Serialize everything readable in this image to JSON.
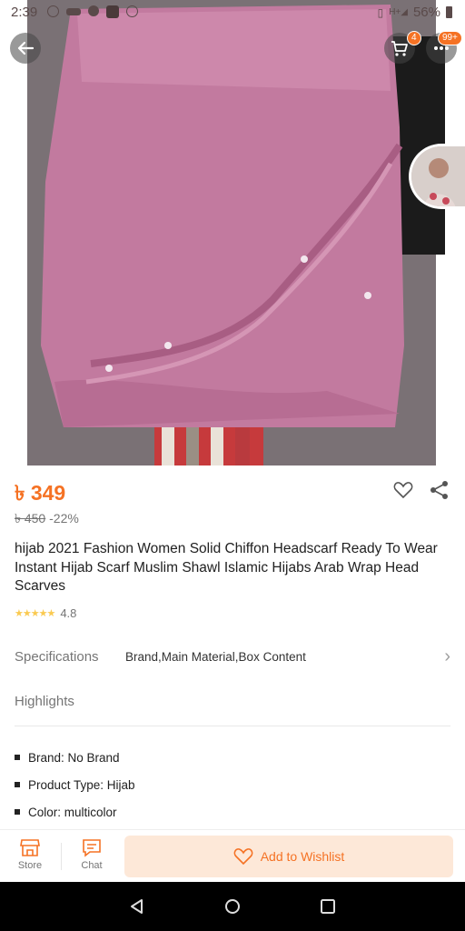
{
  "status_bar": {
    "time": "2:39",
    "battery": "56%",
    "signal": "H+"
  },
  "header": {
    "back_icon": "arrow-left-icon",
    "cart_icon": "cart-icon",
    "cart_count": "4",
    "more_icon": "more-icon",
    "more_badge": "99+"
  },
  "product": {
    "price": "৳ 349",
    "original_price": "৳ 450",
    "discount": "-22%",
    "title": "hijab 2021 Fashion Women Solid Chiffon Headscarf Ready To Wear Instant Hijab Scarf Muslim Shawl Islamic Hijabs Arab Wrap Head Scarves",
    "rating": "4.8",
    "stars": "★★★★★"
  },
  "specifications": {
    "label": "Specifications",
    "value": "Brand,Main Material,Box Content"
  },
  "highlights": {
    "label": "Highlights",
    "items": [
      {
        "text": "Brand: No Brand"
      },
      {
        "text": "Product Type: Hijab"
      },
      {
        "text": "Color: multicolor"
      }
    ]
  },
  "bottom_bar": {
    "store_label": "Store",
    "chat_label": "Chat",
    "wishlist_label": "Add to Wishlist"
  },
  "colors": {
    "accent": "#f57224",
    "wishlist_bg": "#fde8d8",
    "fabric": "#c27a9f"
  }
}
